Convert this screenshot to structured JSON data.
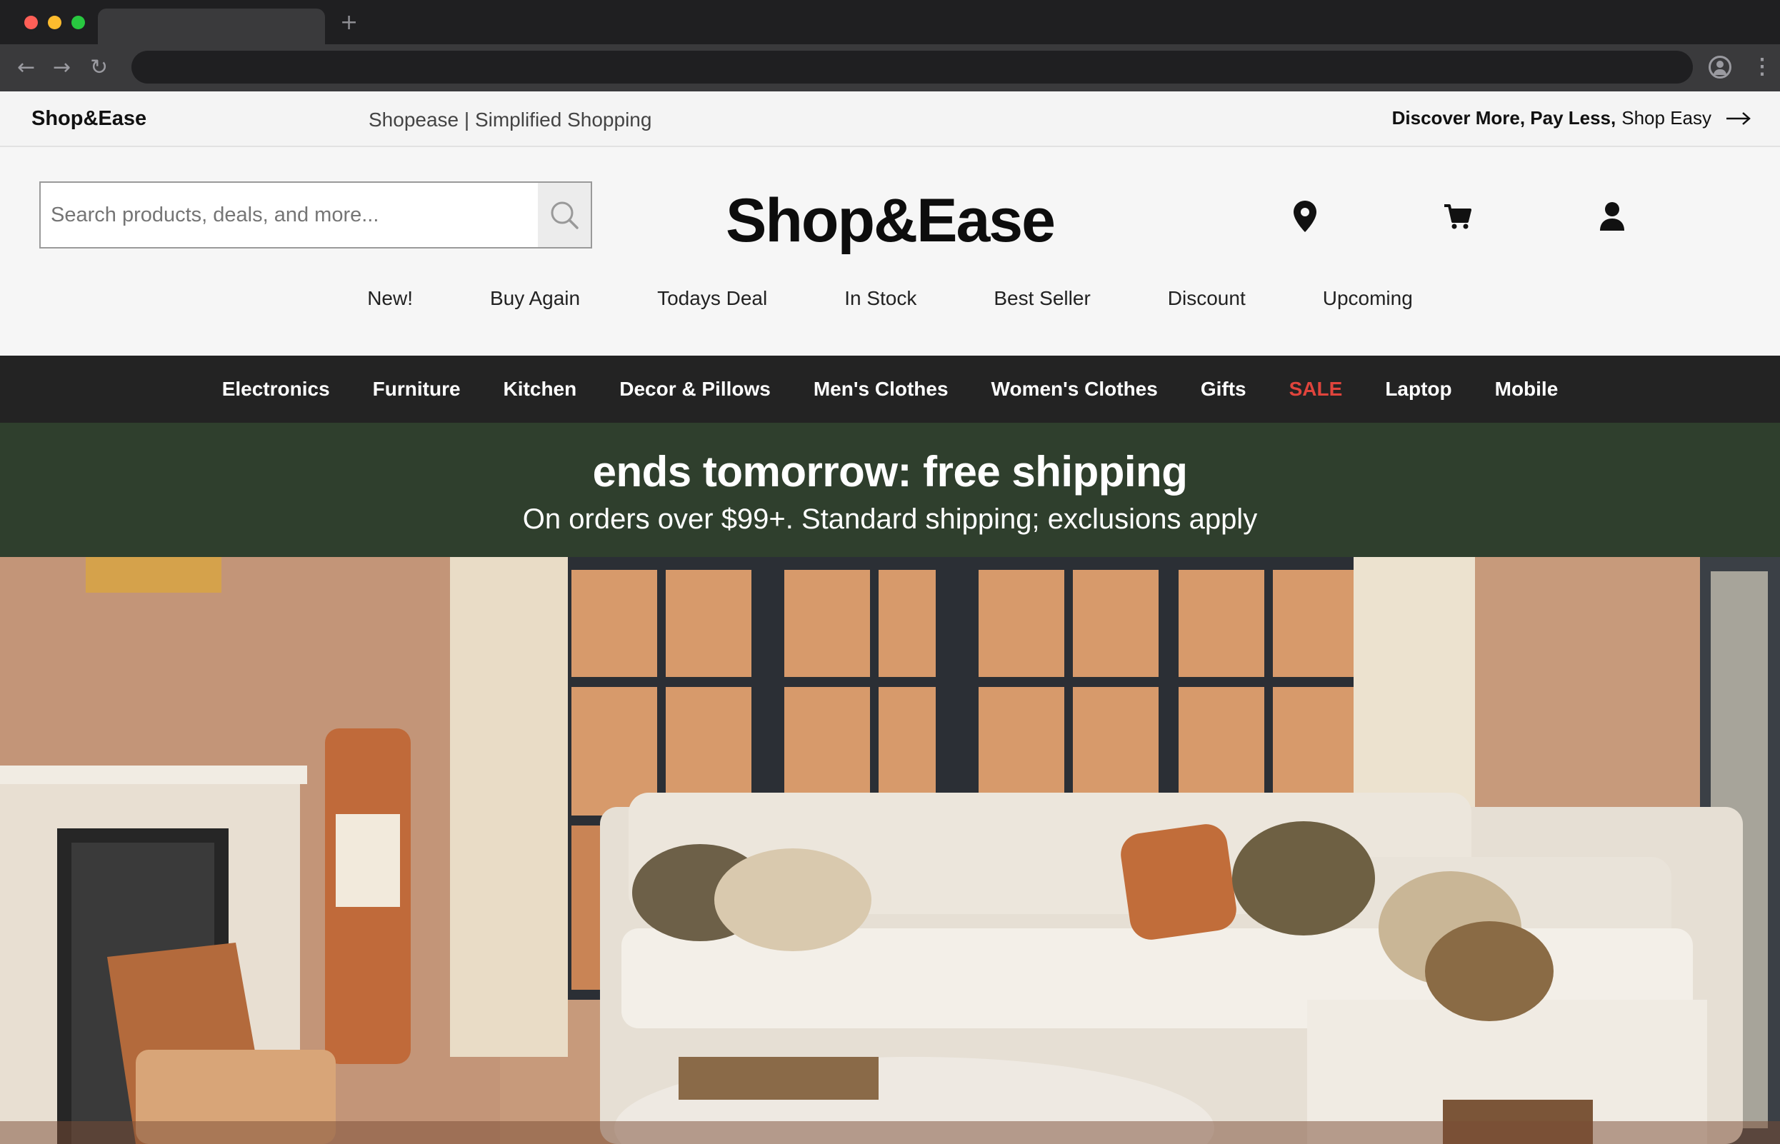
{
  "browser": {
    "new_tab_glyph": "+",
    "back_glyph": "←",
    "forward_glyph": "→",
    "reload_glyph": "↻",
    "menu_glyph": "⋮"
  },
  "topbar": {
    "brand": "Shop&Ease",
    "tagline": "Shopease | Simplified Shopping",
    "promo_bold": "Discover More, Pay Less,",
    "promo_regular": "Shop Easy"
  },
  "header": {
    "search_placeholder": "Search products, deals, and more...",
    "logo": "Shop&Ease",
    "icons": [
      "location-pin-icon",
      "cart-icon",
      "user-icon"
    ]
  },
  "quick_links": [
    "New!",
    "Buy Again",
    "Todays Deal",
    "In Stock",
    "Best Seller",
    "Discount",
    "Upcoming"
  ],
  "categories": [
    "Electronics",
    "Furniture",
    "Kitchen",
    "Decor & Pillows",
    "Men's Clothes",
    "Women's Clothes",
    "Gifts",
    "SALE",
    "Laptop",
    "Mobile"
  ],
  "banner": {
    "headline": "ends tomorrow: free shipping",
    "subline": "On orders over $99+. Standard shipping; exclusions apply"
  },
  "colors": {
    "category_bar": "#232323",
    "banner_bg": "#2f3f2d",
    "sale": "#e0443c"
  }
}
